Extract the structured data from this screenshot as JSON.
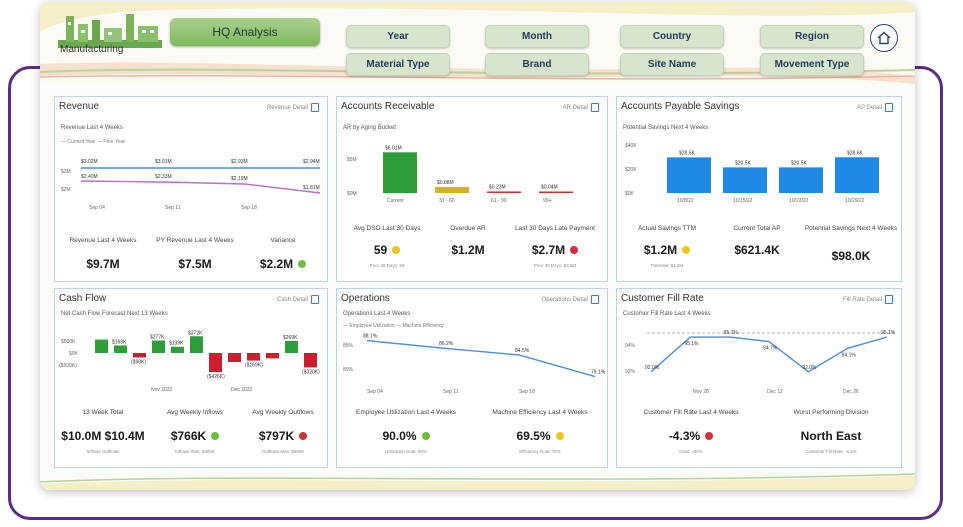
{
  "header": {
    "logo_text": "Manufacturing",
    "title": "HQ Analysis",
    "filters": [
      "Year",
      "Month",
      "Country",
      "Region",
      "Material Type",
      "Brand",
      "Site Name",
      "Movement Type"
    ]
  },
  "revenue": {
    "title": "Revenue",
    "detail": "Revenue Detail",
    "subtitle": "Revenue Last 4 Weeks",
    "legend": "— Current Year — Prior Year",
    "y_ticks": [
      "$3M",
      "$2M"
    ],
    "x_ticks": [
      "Sep 04",
      "Sep 11",
      "Sep 18"
    ],
    "current_labels": [
      "$3.02M",
      "$3.01M",
      "$2.93M",
      "$2.94M"
    ],
    "prior_labels": [
      "$2.40M",
      "$2.33M",
      "$2.19M",
      "$1.81M"
    ],
    "kpis": [
      {
        "label": "Revenue Last 4 Weeks",
        "value": "$9.7M"
      },
      {
        "label": "PY Revenue Last 4 Weeks",
        "value": "$7.5M"
      },
      {
        "label": "Variance",
        "value": "$2.2M",
        "status": "green"
      }
    ]
  },
  "ar": {
    "title": "Accounts Receivable",
    "detail": "AR Detail",
    "subtitle": "AR by Aging Bucket",
    "y_ticks": [
      "$5M",
      "$0M"
    ],
    "buckets": [
      {
        "label": "Current",
        "value_label": "$6.01M",
        "value": 6.01,
        "color": "#2e9e3a"
      },
      {
        "label": "31 - 60",
        "value_label": "$0.88M",
        "value": 0.88,
        "color": "#d4b024"
      },
      {
        "label": "61 - 90",
        "value_label": "$0.23M",
        "value": 0.23,
        "color": "#c0392b"
      },
      {
        "label": "90+",
        "value_label": "$0.04M",
        "value": 0.04,
        "color": "#c0392b"
      }
    ],
    "kpis": [
      {
        "label": "Avg DSO Last 30 Days",
        "value": "59",
        "status": "yellow",
        "sub": "Prior 30 Days: 59"
      },
      {
        "label": "Overdue AR",
        "value": "$1.2M"
      },
      {
        "label": "Last 30 Days Late Payment",
        "value": "$2.7M",
        "status": "red",
        "sub": "Prior 30 Days: $2.6M"
      }
    ]
  },
  "ap": {
    "title": "Accounts Payable Savings",
    "detail": "AP Detail",
    "subtitle": "Potential Savings Next 4 Weeks",
    "y_ticks": [
      "$40K",
      "$20K",
      "$0K"
    ],
    "bars": [
      {
        "label": "10/8/22",
        "value_label": "$28.5K",
        "value": 28.5
      },
      {
        "label": "10/15/22",
        "value_label": "$20.5K",
        "value": 20.5
      },
      {
        "label": "10/22/22",
        "value_label": "$20.5K",
        "value": 20.5
      },
      {
        "label": "10/29/22",
        "value_label": "$28.6K",
        "value": 28.6
      }
    ],
    "kpis": [
      {
        "label": "Actual Savings TTM",
        "value": "$1.2M",
        "status": "yellow",
        "sub": "Potential: $1.8M"
      },
      {
        "label": "Current Total AP",
        "value": "$621.4K"
      },
      {
        "label": "Potential Savings Next 4 Weeks",
        "value": "$98.0K"
      }
    ]
  },
  "cashflow": {
    "title": "Cash Flow",
    "detail": "Cash Detail",
    "subtitle": "Net Cash Flow Forecast Next 13 Weeks",
    "y_ticks": [
      "$500K",
      "$0K",
      "($500K)"
    ],
    "x_ticks": [
      "Nov 2022",
      "Dec 2022"
    ],
    "bars": [
      {
        "value": 300,
        "label": ""
      },
      {
        "value": 168,
        "label": "$168K"
      },
      {
        "value": -98,
        "label": "($98K)"
      },
      {
        "value": 277,
        "label": "$277K"
      },
      {
        "value": 139,
        "label": "$139K"
      },
      {
        "value": 372,
        "label": "$372K"
      },
      {
        "value": -426,
        "label": "($426K)"
      },
      {
        "value": -200,
        "label": ""
      },
      {
        "value": -169,
        "label": "($169K)"
      },
      {
        "value": -120,
        "label": ""
      },
      {
        "value": 269,
        "label": "$269K"
      },
      {
        "value": -320,
        "label": "($320K)"
      }
    ],
    "kpis": [
      {
        "label": "13 Week Total",
        "value": "$10.0M $10.4M",
        "sub": "Inflows     Outflows"
      },
      {
        "label": "Avg Weekly Inflows",
        "value": "$766K",
        "status": "green",
        "sub": "Inflows Plan: $400K"
      },
      {
        "label": "Avg Weekly Outflows",
        "value": "$797K",
        "status": "red",
        "sub": "Outflows Max: $680K"
      }
    ]
  },
  "ops": {
    "title": "Operations",
    "detail": "Operations Detail",
    "subtitle": "Operations Last 4 Weeks",
    "legend": "— Employee Utilization — Machine Efficiency",
    "y_ticks": [
      "85%",
      "80%"
    ],
    "x_ticks": [
      "Sep 04",
      "Sep 11",
      "Sep 18"
    ],
    "series_values": [
      88.1,
      86.2,
      84.5,
      79.1
    ],
    "series_labels": [
      "88.1%",
      "86.2%",
      "84.5%",
      "79.1%"
    ],
    "kpis": [
      {
        "label": "Employee Utilization Last 4 Weeks",
        "value": "90.0%",
        "status": "green",
        "sub": "Utilization Goal: 80%"
      },
      {
        "label": "Machine Efficiency Last 4 Weeks",
        "value": "69.5%",
        "status": "yellow",
        "sub": "Efficiency Goal: 75%"
      }
    ]
  },
  "fill": {
    "title": "Customer Fill Rate",
    "detail": "Fill Rate Detail",
    "subtitle": "Customer Fill Rate Last 4 Weeks",
    "y_ticks": [
      "94%",
      "92%"
    ],
    "x_ticks": [
      "Nov 28",
      "Dec 12",
      "Dec 26"
    ],
    "series_values": [
      92.0,
      95.1,
      95.1,
      94.7,
      92.0,
      94.1,
      95.1
    ],
    "series_labels": [
      "92.0%",
      "95.1%",
      "95.1%",
      "94.7%",
      "92.0%",
      "94.1%",
      "95.1%"
    ],
    "kpis": [
      {
        "label": "Customer Fill Rate Last 4 Weeks",
        "value": "-4.3%",
        "status": "red",
        "sub": "Goal: +50%"
      },
      {
        "label": "Worst Performing Division",
        "value": "North East",
        "sub": "Customer Fill Rate: -5.2%"
      }
    ]
  },
  "colors": {
    "accent_purple": "#5b2d86",
    "bar_blue": "#1e88e5",
    "line_blue": "#4a90d9",
    "line_purple": "#b86fcb",
    "green": "#2e9e3a",
    "red": "#c8202e"
  }
}
